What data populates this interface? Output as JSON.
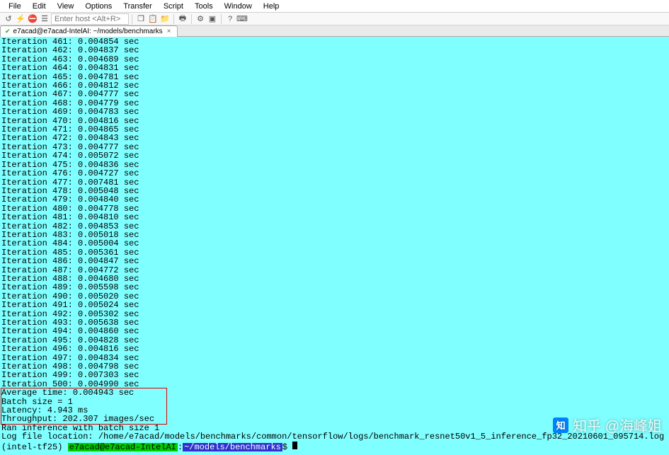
{
  "menubar": [
    "File",
    "Edit",
    "View",
    "Options",
    "Transfer",
    "Script",
    "Tools",
    "Window",
    "Help"
  ],
  "toolbar": {
    "host_placeholder": "Enter host <Alt+R>"
  },
  "tab": {
    "title": "e7acad@e7acad-IntelAI: ~/models/benchmarks"
  },
  "iterations": [
    {
      "n": 461,
      "sec": "0.004854"
    },
    {
      "n": 462,
      "sec": "0.004837"
    },
    {
      "n": 463,
      "sec": "0.004689"
    },
    {
      "n": 464,
      "sec": "0.004831"
    },
    {
      "n": 465,
      "sec": "0.004781"
    },
    {
      "n": 466,
      "sec": "0.004812"
    },
    {
      "n": 467,
      "sec": "0.004777"
    },
    {
      "n": 468,
      "sec": "0.004779"
    },
    {
      "n": 469,
      "sec": "0.004783"
    },
    {
      "n": 470,
      "sec": "0.004816"
    },
    {
      "n": 471,
      "sec": "0.004865"
    },
    {
      "n": 472,
      "sec": "0.004843"
    },
    {
      "n": 473,
      "sec": "0.004777"
    },
    {
      "n": 474,
      "sec": "0.005072"
    },
    {
      "n": 475,
      "sec": "0.004836"
    },
    {
      "n": 476,
      "sec": "0.004727"
    },
    {
      "n": 477,
      "sec": "0.007481"
    },
    {
      "n": 478,
      "sec": "0.005048"
    },
    {
      "n": 479,
      "sec": "0.004840"
    },
    {
      "n": 480,
      "sec": "0.004778"
    },
    {
      "n": 481,
      "sec": "0.004810"
    },
    {
      "n": 482,
      "sec": "0.004853"
    },
    {
      "n": 483,
      "sec": "0.005018"
    },
    {
      "n": 484,
      "sec": "0.005004"
    },
    {
      "n": 485,
      "sec": "0.005361"
    },
    {
      "n": 486,
      "sec": "0.004847"
    },
    {
      "n": 487,
      "sec": "0.004772"
    },
    {
      "n": 488,
      "sec": "0.004680"
    },
    {
      "n": 489,
      "sec": "0.005598"
    },
    {
      "n": 490,
      "sec": "0.005020"
    },
    {
      "n": 491,
      "sec": "0.005024"
    },
    {
      "n": 492,
      "sec": "0.005302"
    },
    {
      "n": 493,
      "sec": "0.005638"
    },
    {
      "n": 494,
      "sec": "0.004860"
    },
    {
      "n": 495,
      "sec": "0.004828"
    },
    {
      "n": 496,
      "sec": "0.004816"
    },
    {
      "n": 497,
      "sec": "0.004834"
    },
    {
      "n": 498,
      "sec": "0.004798"
    },
    {
      "n": 499,
      "sec": "0.007303"
    },
    {
      "n": 500,
      "sec": "0.004990"
    }
  ],
  "summary": {
    "avg_time": "Average time: 0.004943 sec",
    "batch": "Batch size = 1",
    "latency": "Latency: 4.943 ms",
    "throughput": "Throughput: 202.307 images/sec"
  },
  "tail": {
    "ran": "Ran inference with batch size 1",
    "logloc": "Log file location: /home/e7acad/models/benchmarks/common/tensorflow/logs/benchmark_resnet50v1_5_inference_fp32_20210601_095714.log"
  },
  "prompt": {
    "venv": "(intel-tf25) ",
    "userhost": "e7acad@e7acad-IntelAI",
    "colon": ":",
    "cwd": "~/models/benchmarks",
    "dollar": "$ "
  },
  "watermark": "知乎 @海峰姐"
}
